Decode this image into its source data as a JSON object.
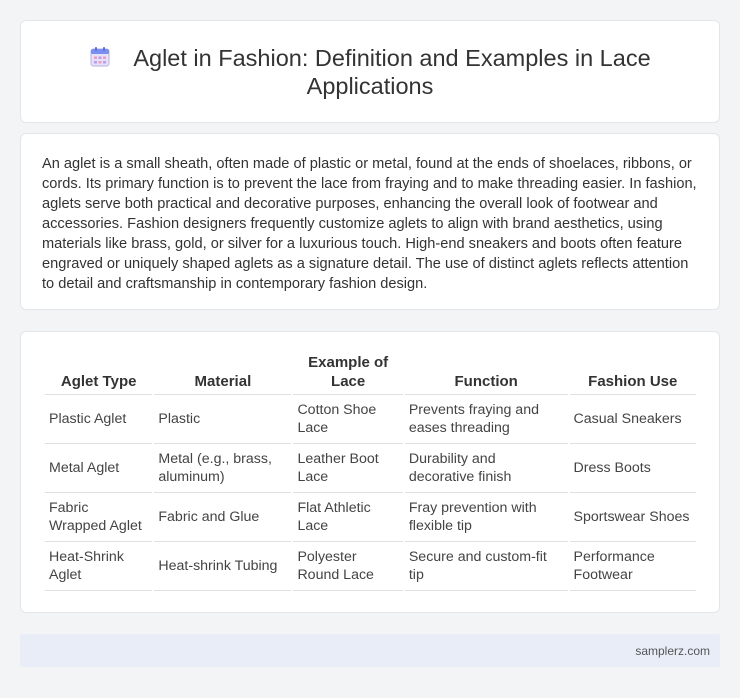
{
  "header": {
    "title": "Aglet in Fashion: Definition and Examples in Lace Applications",
    "icon": "calendar-icon"
  },
  "intro": {
    "text": "An aglet is a small sheath, often made of plastic or metal, found at the ends of shoelaces, ribbons, or cords. Its primary function is to prevent the lace from fraying and to make threading easier. In fashion, aglets serve both practical and decorative purposes, enhancing the overall look of footwear and accessories. Fashion designers frequently customize aglets to align with brand aesthetics, using materials like brass, gold, or silver for a luxurious touch. High-end sneakers and boots often feature engraved or uniquely shaped aglets as a signature detail. The use of distinct aglets reflects attention to detail and craftsmanship in contemporary fashion design."
  },
  "table": {
    "headers": [
      "Aglet Type",
      "Material",
      "Example of Lace",
      "Function",
      "Fashion Use"
    ],
    "rows": [
      [
        "Plastic Aglet",
        "Plastic",
        "Cotton Shoe Lace",
        "Prevents fraying and eases threading",
        "Casual Sneakers"
      ],
      [
        "Metal Aglet",
        "Metal (e.g., brass, aluminum)",
        "Leather Boot Lace",
        "Durability and decorative finish",
        "Dress Boots"
      ],
      [
        "Fabric Wrapped Aglet",
        "Fabric and Glue",
        "Flat Athletic Lace",
        "Fray prevention with flexible tip",
        "Sportswear Shoes"
      ],
      [
        "Heat-Shrink Aglet",
        "Heat-shrink Tubing",
        "Polyester Round Lace",
        "Secure and custom-fit tip",
        "Performance Footwear"
      ]
    ]
  },
  "footer": {
    "text": "samplerz.com"
  }
}
